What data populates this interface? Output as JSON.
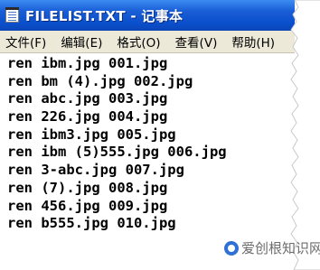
{
  "window": {
    "title": "FILELIST.TXT - 记事本"
  },
  "menu": {
    "items": [
      {
        "label": "文件(F)"
      },
      {
        "label": "编辑(E)"
      },
      {
        "label": "格式(O)"
      },
      {
        "label": "查看(V)"
      },
      {
        "label": "帮助(H)"
      }
    ]
  },
  "editor": {
    "lines": [
      "ren ibm.jpg 001.jpg",
      "ren bm (4).jpg 002.jpg",
      "ren abc.jpg 003.jpg",
      "ren 226.jpg 004.jpg",
      "ren ibm3.jpg 005.jpg",
      "ren ibm (5)555.jpg 006.jpg",
      "ren 3-abc.jpg 007.jpg",
      "ren (7).jpg 008.jpg",
      "ren 456.jpg 009.jpg",
      "ren b555.jpg 010.jpg"
    ]
  },
  "watermark": {
    "text": "爱创根知识网"
  },
  "icons": {
    "app": "notepad-icon",
    "watermark": "watermark-logo-icon"
  }
}
